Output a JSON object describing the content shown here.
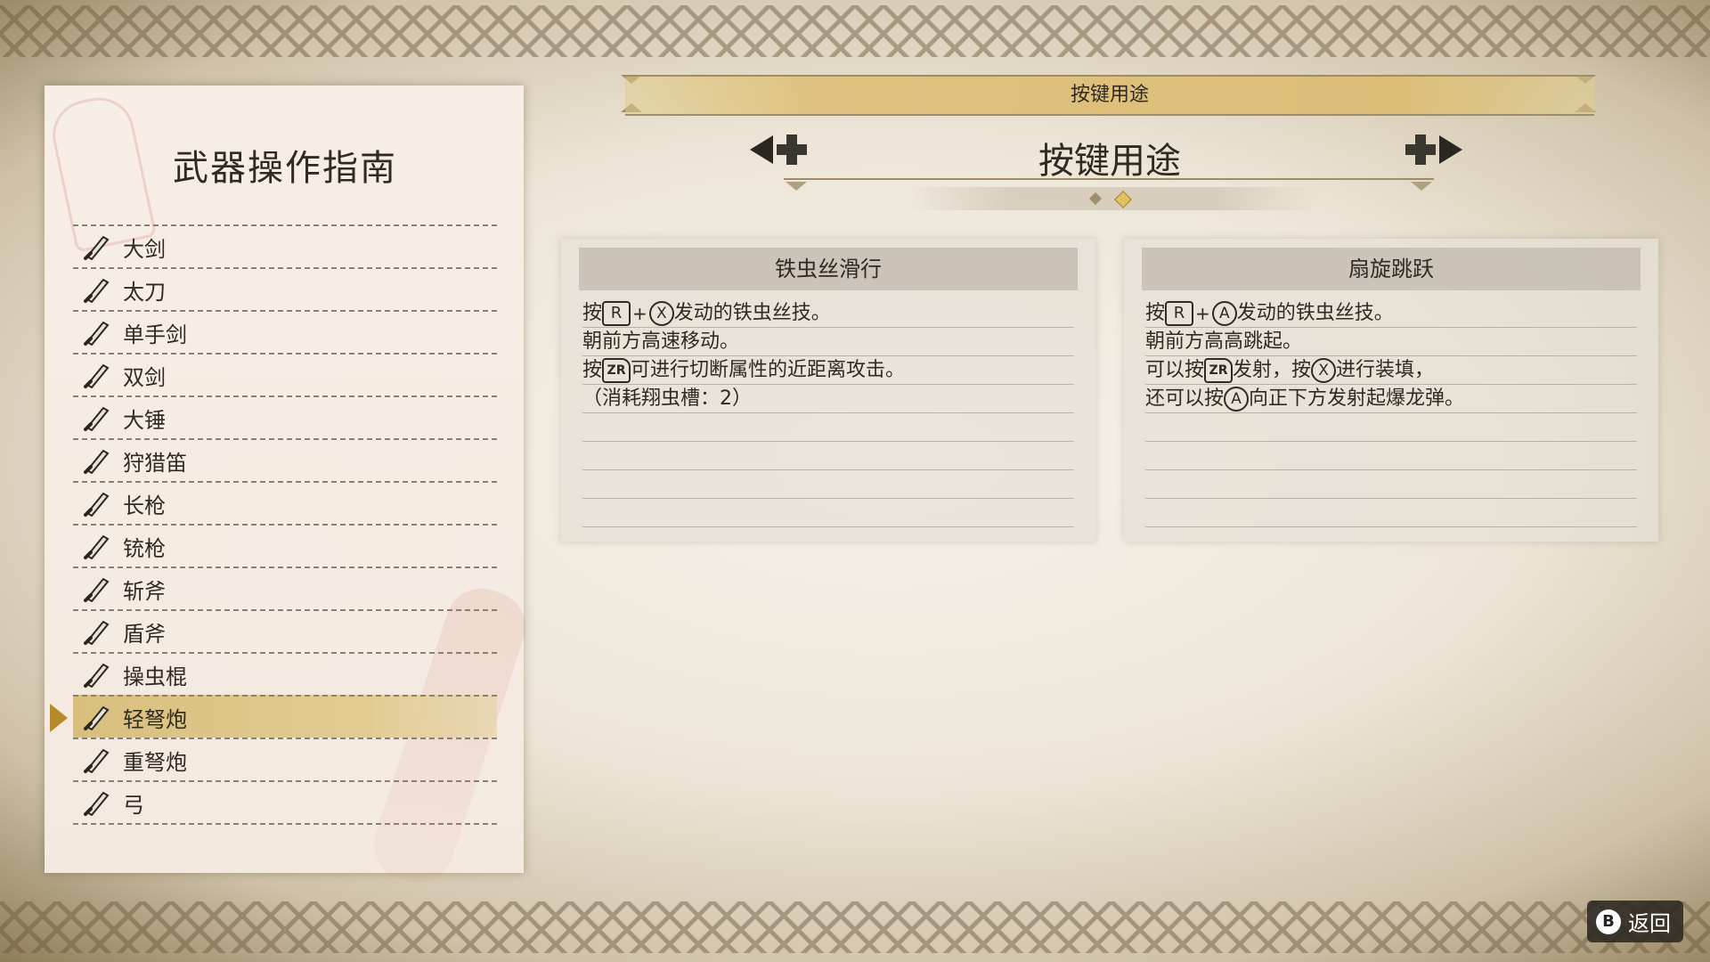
{
  "left_panel": {
    "title": "武器操作指南",
    "weapons": [
      {
        "label": "大剑",
        "icon": "great-sword-icon"
      },
      {
        "label": "太刀",
        "icon": "long-sword-icon"
      },
      {
        "label": "单手剑",
        "icon": "sword-and-shield-icon"
      },
      {
        "label": "双剑",
        "icon": "dual-blades-icon"
      },
      {
        "label": "大锤",
        "icon": "hammer-icon"
      },
      {
        "label": "狩猎笛",
        "icon": "hunting-horn-icon"
      },
      {
        "label": "长枪",
        "icon": "lance-icon"
      },
      {
        "label": "铳枪",
        "icon": "gunlance-icon"
      },
      {
        "label": "斩斧",
        "icon": "switch-axe-icon"
      },
      {
        "label": "盾斧",
        "icon": "charge-blade-icon"
      },
      {
        "label": "操虫棍",
        "icon": "insect-glaive-icon"
      },
      {
        "label": "轻弩炮",
        "icon": "light-bowgun-icon"
      },
      {
        "label": "重弩炮",
        "icon": "heavy-bowgun-icon"
      },
      {
        "label": "弓",
        "icon": "bow-icon"
      }
    ],
    "selected_index": 11
  },
  "header": {
    "bar_label": "按键用途",
    "section_title": "按键用途",
    "page_count": 2,
    "current_page": 2
  },
  "cards": {
    "left": {
      "title": "铁虫丝滑行",
      "l1_pre": "按",
      "l1_btn1": "R",
      "l1_plus": "+",
      "l1_btn2": "X",
      "l1_post": "发动的铁虫丝技。",
      "l2": "朝前方高速移动。",
      "l3_pre": "按",
      "l3_btn": "ZR",
      "l3_post": "可进行切断属性的近距离攻击。",
      "l4": "（消耗翔虫槽：2）"
    },
    "right": {
      "title": "扇旋跳跃",
      "l1_pre": "按",
      "l1_btn1": "R",
      "l1_plus": "+",
      "l1_btn2": "A",
      "l1_post": "发动的铁虫丝技。",
      "l2": "朝前方高高跳起。",
      "l3_pre": "可以按",
      "l3_btn1": "ZR",
      "l3_mid": "发射，按",
      "l3_btn2": "X",
      "l3_post": "进行装填，",
      "l4_pre": "还可以按",
      "l4_btn": "A",
      "l4_post": "向正下方发射起爆龙弹。"
    }
  },
  "footer": {
    "back_button_glyph": "B",
    "back_label": "返回"
  },
  "colors": {
    "header_bar": "#dcbe77",
    "selected_row": "#d8bf7e",
    "cursor": "#b48a2a",
    "active_page_dot": "#e0c060",
    "text": "#2f2a22"
  }
}
